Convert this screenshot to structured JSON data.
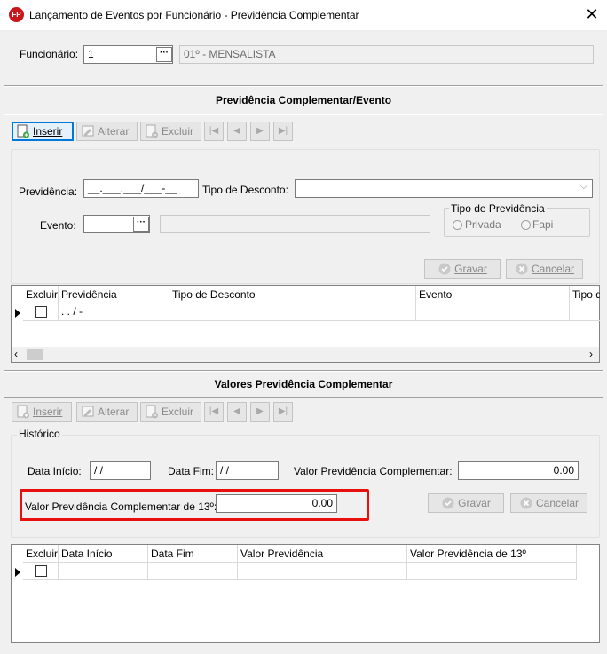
{
  "window": {
    "title": "Lançamento de Eventos por Funcionário - Previdência Complementar",
    "app_icon": "FP"
  },
  "funcionario": {
    "label": "Funcionário:",
    "value": "1",
    "description": "01º - MENSALISTA"
  },
  "section1": {
    "title": "Previdência Complementar/Evento",
    "toolbar": {
      "inserir": "Inserir",
      "alterar": "Alterar",
      "excluir": "Excluir"
    },
    "form": {
      "previdencia_label": "Previdência:",
      "previdencia_mask": "__.___.___/___-__",
      "tipo_desconto_label": "Tipo de Desconto:",
      "evento_label": "Evento:",
      "tipo_previdencia_group": "Tipo de Previdência",
      "option_privada": "Privada",
      "option_fapi": "Fapi",
      "gravar": "Gravar",
      "cancelar": "Cancelar"
    },
    "grid": {
      "columns": [
        "Excluir",
        "Previdência",
        "Tipo de Desconto",
        "Evento",
        "Tipo d"
      ],
      "rows": [
        {
          "previdencia": " .  .  /   -"
        }
      ]
    }
  },
  "section2": {
    "title": "Valores Previdência Complementar",
    "toolbar": {
      "inserir": "Inserir",
      "alterar": "Alterar",
      "excluir": "Excluir"
    },
    "historico": {
      "label": "Histórico",
      "data_inicio_label": "Data Início:",
      "data_inicio_value": " /  /",
      "data_fim_label": "Data Fim:",
      "data_fim_value": " /  /",
      "valor_label": "Valor Previdência Complementar:",
      "valor_value": "0.00",
      "valor13_label": "Valor Previdência Complementar de 13º:",
      "valor13_value": "0.00",
      "gravar": "Gravar",
      "cancelar": "Cancelar"
    },
    "grid": {
      "columns": [
        "Excluir",
        "Data Início",
        "Data Fim",
        "Valor Previdência",
        "Valor Previdência de 13º"
      ]
    }
  },
  "highlight_color": "#e8100f"
}
